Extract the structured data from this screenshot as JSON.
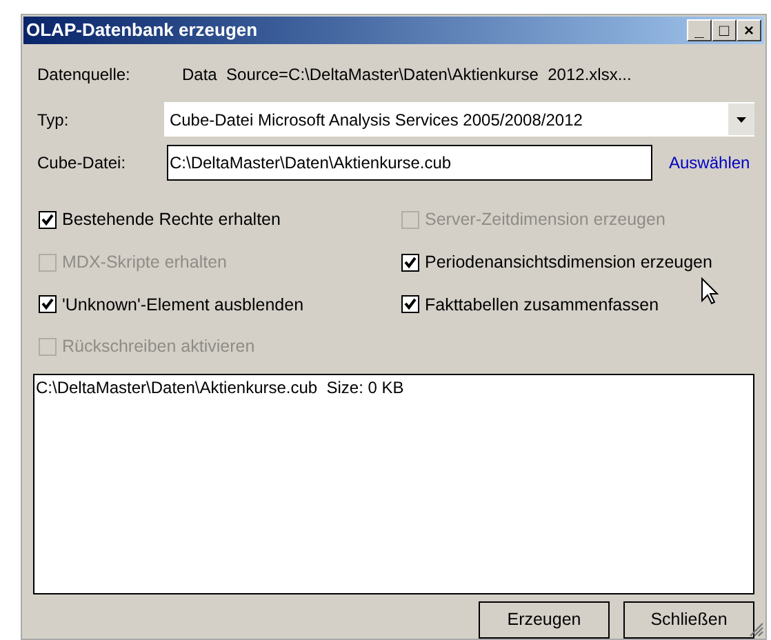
{
  "window": {
    "title": "OLAP-Datenbank erzeugen",
    "controls": [
      "_",
      "□",
      "×"
    ]
  },
  "source": {
    "label": "Datenquelle:",
    "value": "Data  Source=C:\\DeltaMaster\\Daten\\Aktienkurse  2012.xlsx..."
  },
  "type": {
    "label": "Typ:",
    "value": "Cube-Datei Microsoft Analysis Services 2005/2008/2012"
  },
  "cube_file": {
    "label": "Cube-Datei:",
    "value": "C:\\DeltaMaster\\Daten\\Aktienkurse.cub",
    "link": "Auswählen"
  },
  "options": [
    {
      "label": "Bestehende Rechte erhalten",
      "checked": true,
      "disabled": false
    },
    {
      "label": "Server-Zeitdimension erzeugen",
      "checked": false,
      "disabled": true
    },
    {
      "label": "MDX-Skripte erhalten",
      "checked": false,
      "disabled": true
    },
    {
      "label": "Periodenansichtsdimension erzeugen",
      "checked": true,
      "disabled": false
    },
    {
      "label": "'Unknown'-Element ausblenden",
      "checked": true,
      "disabled": false
    },
    {
      "label": "Fakttabellen zusammenfassen",
      "checked": true,
      "disabled": false
    },
    {
      "label": "Rückschreiben aktivieren",
      "checked": false,
      "disabled": true
    }
  ],
  "log": [
    "C:\\DeltaMaster\\Daten\\Aktienkurse.cub  Size: 0 KB"
  ],
  "buttons": [
    "Erzeugen",
    "Schließen"
  ]
}
